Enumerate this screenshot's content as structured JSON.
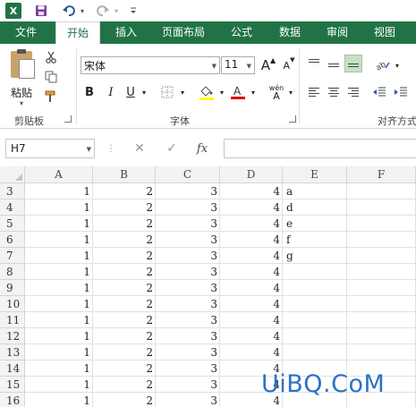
{
  "qat": {
    "app_icon": "excel-logo",
    "app_letter": "X",
    "save_icon": "save-icon",
    "undo_icon": "undo-icon",
    "redo_icon": "redo-icon",
    "customize_icon": "customize-qat-icon"
  },
  "tabs": [
    "文件",
    "开始",
    "插入",
    "页面布局",
    "公式",
    "数据",
    "审阅",
    "视图"
  ],
  "active_tab": "开始",
  "ribbon": {
    "clipboard": {
      "paste_label": "粘贴",
      "group_label": "剪贴板"
    },
    "font": {
      "font_name": "宋体",
      "font_size": "11",
      "group_label": "字体",
      "bold": "B",
      "italic": "I",
      "underline": "U",
      "grow": "A",
      "shrink": "A",
      "phonetic_top": "wén",
      "phonetic_bottom": "A"
    },
    "alignment": {
      "group_label": "对齐方式"
    }
  },
  "formula_bar": {
    "name_box": "H7",
    "fx_label": "fx",
    "formula": ""
  },
  "columns": [
    "A",
    "B",
    "C",
    "D",
    "E",
    "F"
  ],
  "rows": [
    {
      "n": "3",
      "a": "1",
      "b": "2",
      "c": "3",
      "d": "4",
      "e": "a"
    },
    {
      "n": "4",
      "a": "1",
      "b": "2",
      "c": "3",
      "d": "4",
      "e": "d"
    },
    {
      "n": "5",
      "a": "1",
      "b": "2",
      "c": "3",
      "d": "4",
      "e": "e"
    },
    {
      "n": "6",
      "a": "1",
      "b": "2",
      "c": "3",
      "d": "4",
      "e": "f"
    },
    {
      "n": "7",
      "a": "1",
      "b": "2",
      "c": "3",
      "d": "4",
      "e": "g"
    },
    {
      "n": "8",
      "a": "1",
      "b": "2",
      "c": "3",
      "d": "4",
      "e": ""
    },
    {
      "n": "9",
      "a": "1",
      "b": "2",
      "c": "3",
      "d": "4",
      "e": ""
    },
    {
      "n": "10",
      "a": "1",
      "b": "2",
      "c": "3",
      "d": "4",
      "e": ""
    },
    {
      "n": "11",
      "a": "1",
      "b": "2",
      "c": "3",
      "d": "4",
      "e": ""
    },
    {
      "n": "12",
      "a": "1",
      "b": "2",
      "c": "3",
      "d": "4",
      "e": ""
    },
    {
      "n": "13",
      "a": "1",
      "b": "2",
      "c": "3",
      "d": "4",
      "e": ""
    },
    {
      "n": "14",
      "a": "1",
      "b": "2",
      "c": "3",
      "d": "4",
      "e": ""
    },
    {
      "n": "15",
      "a": "1",
      "b": "2",
      "c": "3",
      "d": "4",
      "e": ""
    },
    {
      "n": "16",
      "a": "1",
      "b": "2",
      "c": "3",
      "d": "4",
      "e": ""
    }
  ],
  "watermark": "UiBQ.CoM",
  "colors": {
    "excel_green": "#217346",
    "watermark_blue": "#2c72c7"
  }
}
